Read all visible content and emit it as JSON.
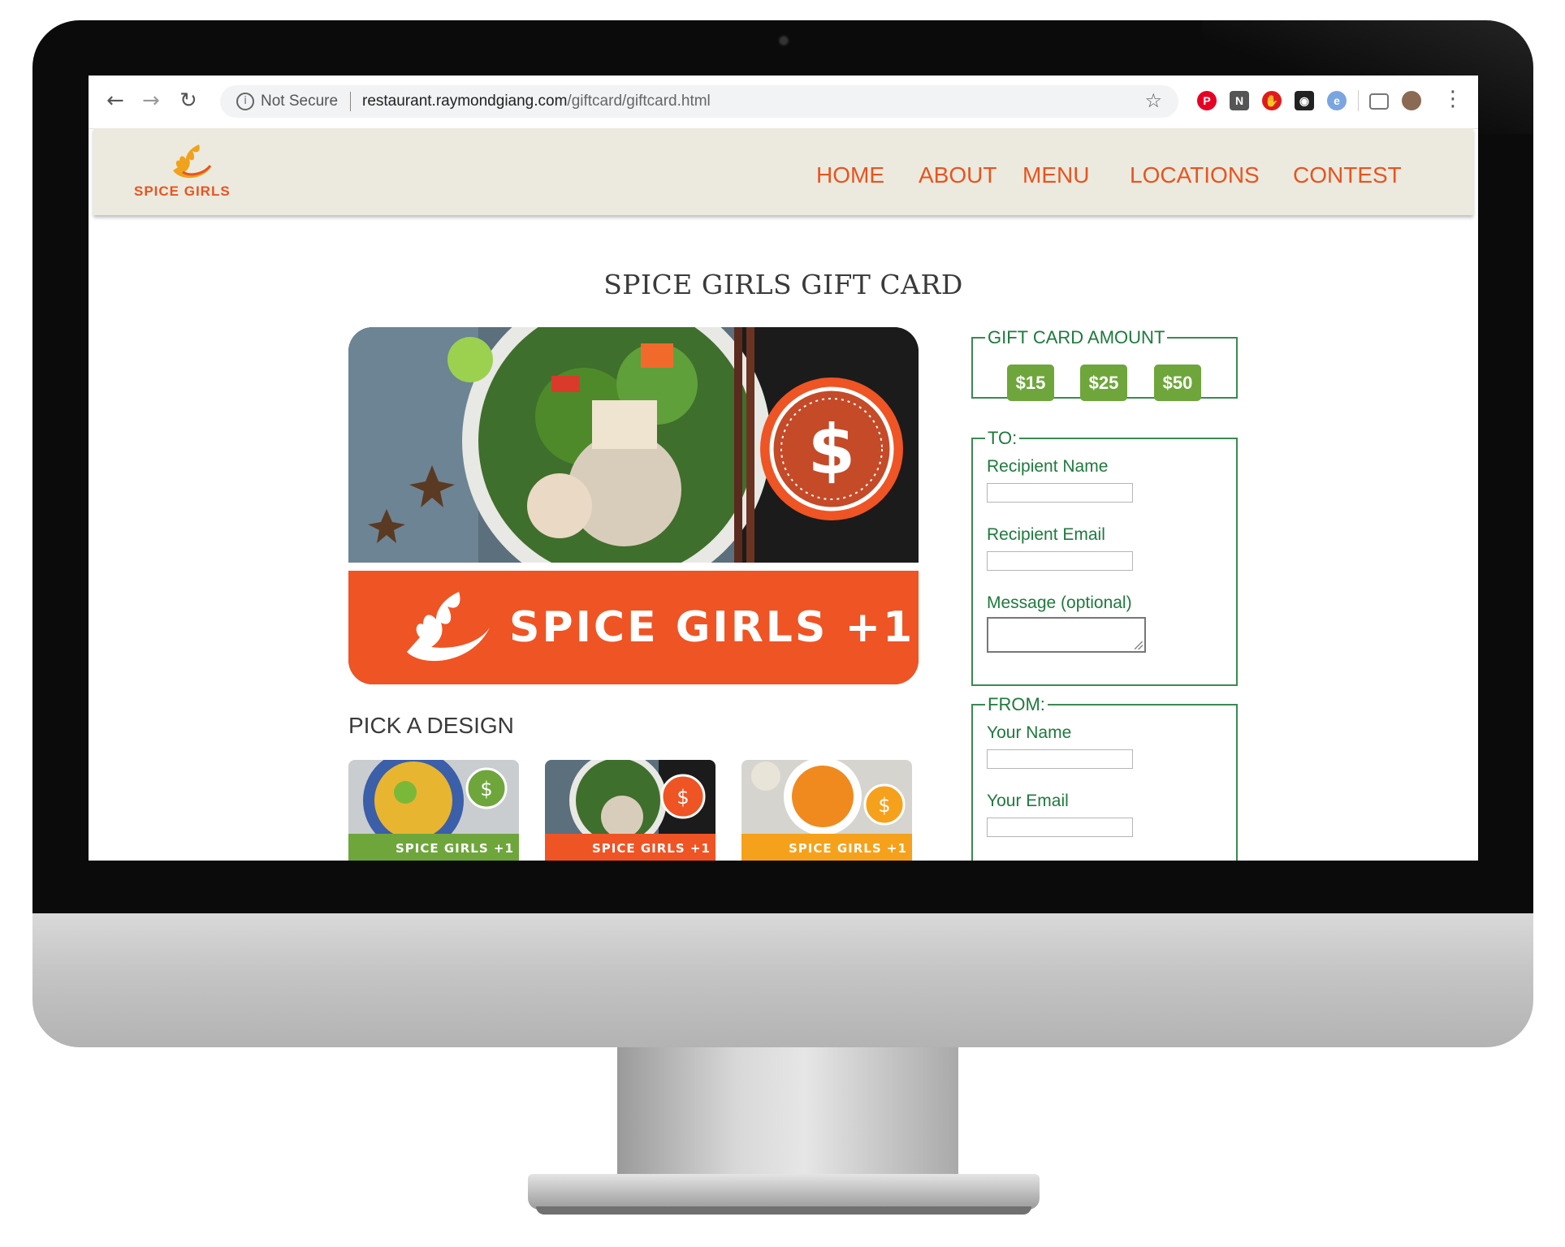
{
  "browser": {
    "security_label": "Not Secure",
    "url_host": "restaurant.raymondgiang.com",
    "url_path": "/giftcard/giftcard.html",
    "extensions": [
      "pinterest-icon",
      "notion-icon",
      "adblock-icon",
      "camera-icon",
      "edge-icon",
      "cast-icon",
      "profile-avatar"
    ]
  },
  "site": {
    "logo_text": "SPICE GIRLS",
    "nav": [
      "HOME",
      "ABOUT",
      "MENU",
      "LOCATIONS",
      "CONTEST"
    ],
    "accent_color": "#e7541f",
    "form_color": "#1e7a3c",
    "button_color": "#6ea63c"
  },
  "page": {
    "title": "SPICE GIRLS GIFT CARD",
    "card_brand": "SPICE GIRLS +1",
    "pick_design_heading": "PICK A DESIGN",
    "designs": [
      {
        "label": "SPICE GIRLS +1",
        "color": "#6ea63c"
      },
      {
        "label": "SPICE GIRLS +1",
        "color": "#ef5424"
      },
      {
        "label": "SPICE GIRLS +1",
        "color": "#f6a11b"
      }
    ]
  },
  "form": {
    "amount_legend": "GIFT CARD AMOUNT",
    "amounts": [
      "$15",
      "$25",
      "$50"
    ],
    "to_legend": "TO:",
    "recipient_name_label": "Recipient Name",
    "recipient_email_label": "Recipient Email",
    "message_label": "Message (optional)",
    "from_legend": "FROM:",
    "your_name_label": "Your Name",
    "your_email_label": "Your Email"
  }
}
